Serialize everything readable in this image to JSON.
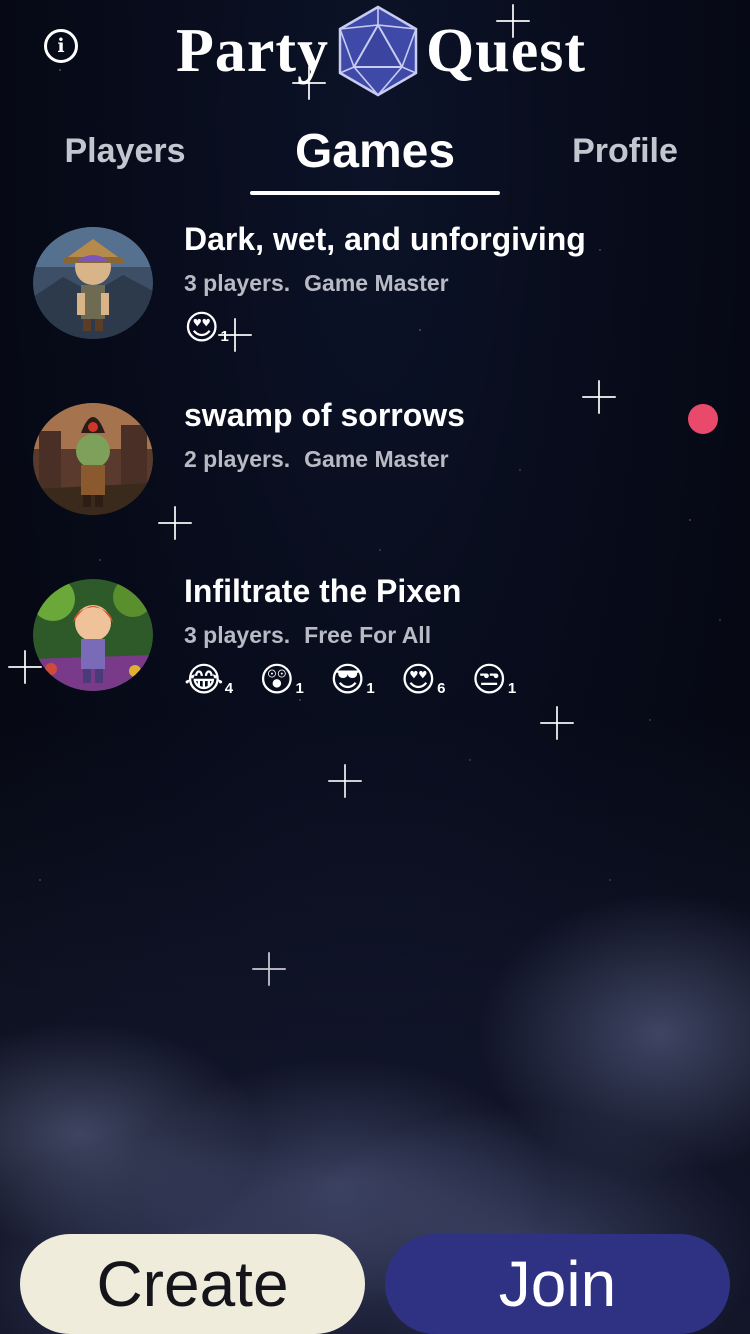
{
  "app": {
    "logo_word_left": "Party",
    "logo_word_right": "Quest",
    "logo_icon": "d20-icon",
    "info_glyph": "i"
  },
  "tabs": [
    {
      "label": "Players",
      "active": false
    },
    {
      "label": "Games",
      "active": true
    },
    {
      "label": "Profile",
      "active": false
    }
  ],
  "games": [
    {
      "title": "Dark, wet, and unforgiving",
      "players": "3 players.",
      "mode": "Game Master",
      "unread": false,
      "reactions": [
        {
          "emoji": "😍",
          "count": "1"
        }
      ]
    },
    {
      "title": "swamp of sorrows",
      "players": "2 players.",
      "mode": "Game Master",
      "unread": true,
      "reactions": []
    },
    {
      "title": "Infiltrate the Pixen",
      "players": "3 players.",
      "mode": "Free For All",
      "unread": false,
      "reactions": [
        {
          "emoji": "😂",
          "count": "4"
        },
        {
          "emoji": "😲",
          "count": "1"
        },
        {
          "emoji": "😎",
          "count": "1"
        },
        {
          "emoji": "😍",
          "count": "6"
        },
        {
          "emoji": "😒",
          "count": "1"
        }
      ]
    }
  ],
  "buttons": {
    "create": "Create",
    "join": "Join"
  },
  "colors": {
    "background": "#070a18",
    "unread_dot": "#e94a6c",
    "create_button": "#efecdc",
    "join_button": "#2f3183",
    "d20": "#3f4aa8"
  }
}
